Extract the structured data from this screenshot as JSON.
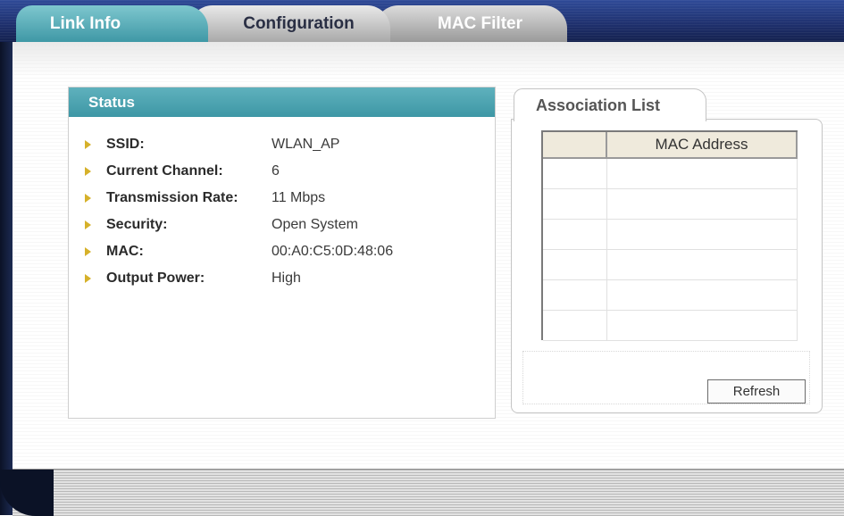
{
  "tabs": [
    {
      "label": "Link Info"
    },
    {
      "label": "Configuration"
    },
    {
      "label": "MAC Filter"
    }
  ],
  "status": {
    "title": "Status",
    "rows": [
      {
        "label": "SSID:",
        "value": "WLAN_AP"
      },
      {
        "label": "Current Channel:",
        "value": "6"
      },
      {
        "label": "Transmission Rate:",
        "value": "11 Mbps"
      },
      {
        "label": "Security:",
        "value": "Open System"
      },
      {
        "label": "MAC:",
        "value": "00:A0:C5:0D:48:06"
      },
      {
        "label": "Output Power:",
        "value": "High"
      }
    ]
  },
  "association": {
    "tab_label": "Association List",
    "columns": [
      "",
      "MAC Address"
    ],
    "refresh_label": "Refresh"
  },
  "colors": {
    "active_tab": "#3f98a6",
    "bullet": "#d6b12a",
    "header_bg": "#3e97a5"
  }
}
